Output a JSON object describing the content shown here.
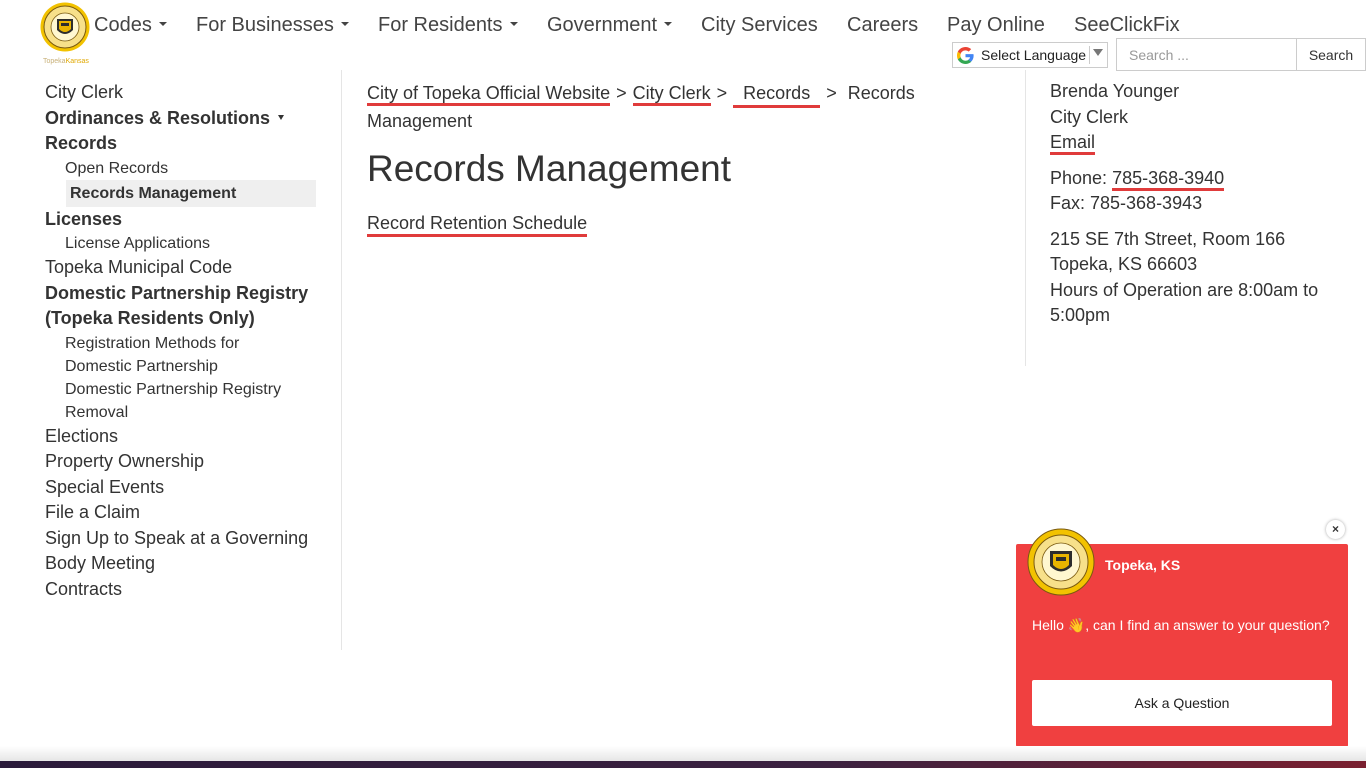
{
  "header": {
    "logo_alt": "City of Topeka seal",
    "logo_sub_1": "Topeka",
    "logo_sub_2": "Kansas",
    "nav": [
      {
        "label": "Codes",
        "has_menu": true
      },
      {
        "label": "For Businesses",
        "has_menu": true
      },
      {
        "label": "For Residents",
        "has_menu": true
      },
      {
        "label": "Government",
        "has_menu": true
      },
      {
        "label": "City Services",
        "has_menu": false
      },
      {
        "label": "Careers",
        "has_menu": false
      },
      {
        "label": "Pay Online",
        "has_menu": false
      },
      {
        "label": "SeeClickFix",
        "has_menu": false
      }
    ],
    "language_label": "Select Language",
    "search_placeholder": "Search ...",
    "search_button": "Search"
  },
  "sidebar": {
    "items": [
      {
        "label": "City Clerk"
      },
      {
        "label": "Ordinances & Resolutions"
      },
      {
        "label": "Records"
      },
      {
        "label": "Open Records"
      },
      {
        "label": "Records Management"
      },
      {
        "label": "Licenses"
      },
      {
        "label": "License Applications"
      },
      {
        "label": "Topeka Municipal Code"
      },
      {
        "label": "Domestic Partnership Registry (Topeka Residents Only)"
      },
      {
        "label": "Registration Methods for Domestic Partnership"
      },
      {
        "label": "Domestic Partnership Registry Removal"
      },
      {
        "label": "Elections"
      },
      {
        "label": "Property Ownership"
      },
      {
        "label": "Special Events"
      },
      {
        "label": "File a Claim"
      },
      {
        "label": "Sign Up to Speak at a Governing Body Meeting"
      },
      {
        "label": "Contracts"
      }
    ]
  },
  "main": {
    "breadcrumb": {
      "home": "City of Topeka Official Website",
      "parent": "City Clerk",
      "current": "Records",
      "page": "Records Management",
      "separator": ">"
    },
    "title": "Records Management",
    "link": "Record Retention Schedule"
  },
  "contact": {
    "name": "Brenda Younger",
    "role": "City Clerk",
    "email_label": "Email",
    "phone_label": "Phone:",
    "phone": "785-368-3940",
    "fax": "Fax: 785-368-3943",
    "address_1": "215 SE 7th Street, Room 166",
    "address_2": "Topeka, KS 66603",
    "hours": "Hours of Operation are 8:00am to 5:00pm"
  },
  "chat": {
    "title": "Topeka, KS",
    "message_1": "Hello",
    "message_2": ", can I find an answer to your question?",
    "button": "Ask a Question",
    "close": "×"
  },
  "colors": {
    "accent_red": "#e03b3b",
    "chat_red": "#f04040",
    "seal_gold": "#e8b400"
  }
}
